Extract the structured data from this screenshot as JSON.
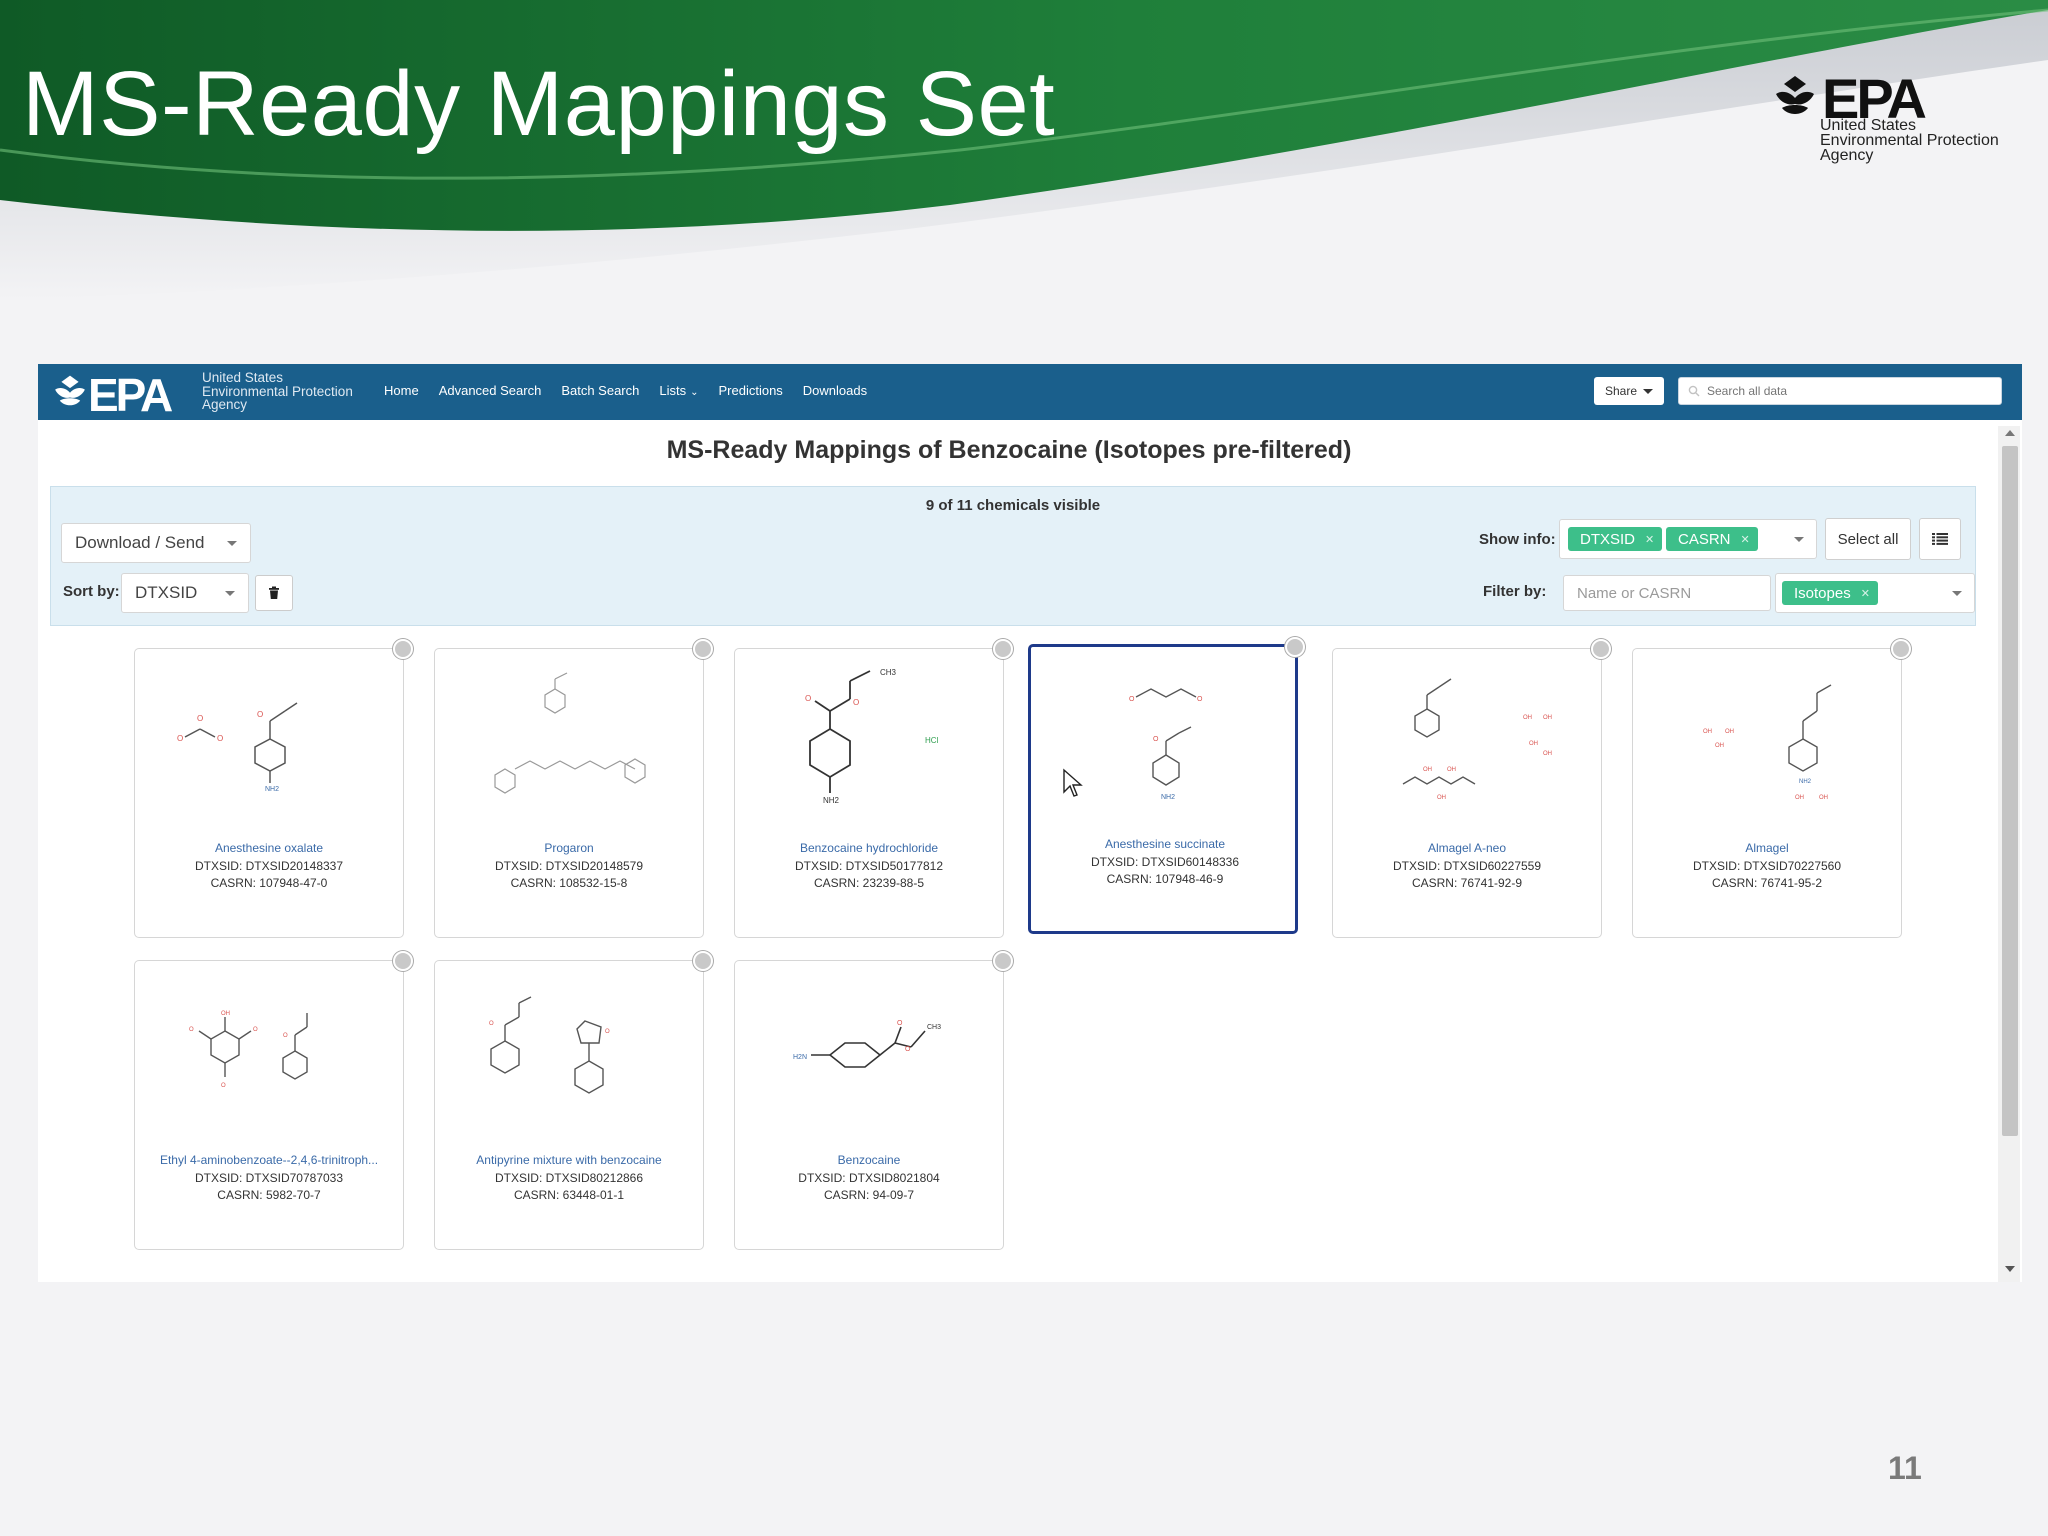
{
  "slide": {
    "title": "MS-Ready Mappings Set",
    "logo_wordmark": "EPA",
    "logo_agency": "United States\nEnvironmental Protection\nAgency",
    "page_number": "11",
    "colors": {
      "header_green": "#1e7a38",
      "header_dark_green": "#0f4f22"
    }
  },
  "app": {
    "navbar": {
      "logo_wordmark": "EPA",
      "logo_agency": "United States\nEnvironmental Protection\nAgency",
      "links": [
        "Home",
        "Advanced Search",
        "Batch Search",
        "Lists",
        "Predictions",
        "Downloads"
      ],
      "share_label": "Share",
      "search_placeholder": "Search all data",
      "bar_color": "#1a5f8c"
    },
    "heading": "MS-Ready Mappings of Benzocaine (Isotopes pre-filtered)",
    "toolbar": {
      "visible_count": "9 of 11 chemicals visible",
      "download_label": "Download / Send",
      "sort_label": "Sort by:",
      "sort_value": "DTXSID",
      "show_info_label": "Show info:",
      "show_info_tags": [
        "DTXSID",
        "CASRN"
      ],
      "select_all_label": "Select all",
      "filter_label": "Filter by:",
      "filter_placeholder": "Name or CASRN",
      "filter_tags": [
        "Isotopes"
      ],
      "tag_color": "#3dbf8a"
    },
    "cards": [
      {
        "name": "Anesthesine oxalate",
        "dtxsid": "DTXSID: DTXSID20148337",
        "casrn": "CASRN: 107948-47-0",
        "selected": false
      },
      {
        "name": "Progaron",
        "dtxsid": "DTXSID: DTXSID20148579",
        "casrn": "CASRN: 108532-15-8",
        "selected": false
      },
      {
        "name": "Benzocaine hydrochloride",
        "dtxsid": "DTXSID: DTXSID50177812",
        "casrn": "CASRN: 23239-88-5",
        "selected": false
      },
      {
        "name": "Anesthesine succinate",
        "dtxsid": "DTXSID: DTXSID60148336",
        "casrn": "CASRN: 107948-46-9",
        "selected": true
      },
      {
        "name": "Almagel A-neo",
        "dtxsid": "DTXSID: DTXSID60227559",
        "casrn": "CASRN: 76741-92-9",
        "selected": false
      },
      {
        "name": "Almagel",
        "dtxsid": "DTXSID: DTXSID70227560",
        "casrn": "CASRN: 76741-95-2",
        "selected": false
      },
      {
        "name": "Ethyl 4-aminobenzoate--2,4,6-trinitroph...",
        "dtxsid": "DTXSID: DTXSID70787033",
        "casrn": "CASRN: 5982-70-7",
        "selected": false
      },
      {
        "name": "Antipyrine mixture with benzocaine",
        "dtxsid": "DTXSID: DTXSID80212866",
        "casrn": "CASRN: 63448-01-1",
        "selected": false
      },
      {
        "name": "Benzocaine",
        "dtxsid": "DTXSID: DTXSID8021804",
        "casrn": "CASRN: 94-09-7",
        "selected": false
      }
    ]
  }
}
